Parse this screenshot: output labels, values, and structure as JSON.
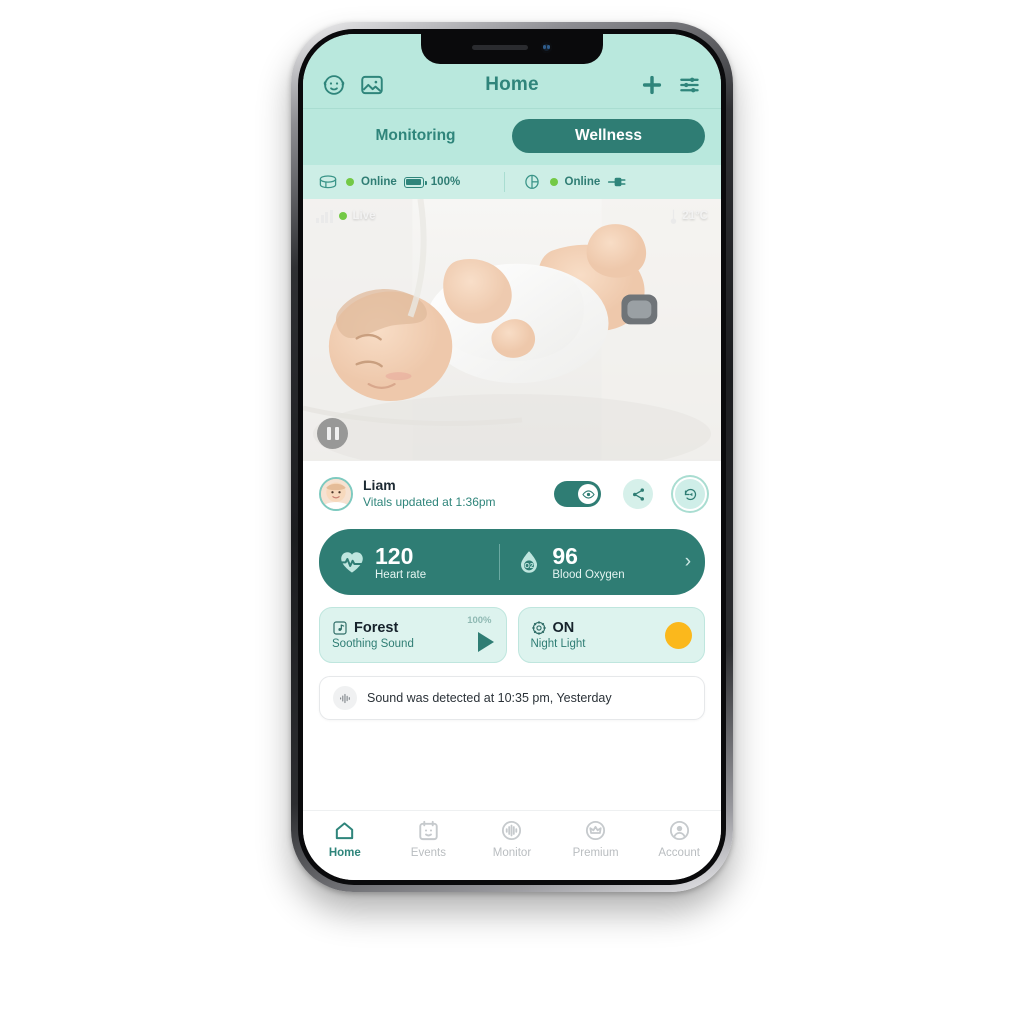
{
  "header": {
    "title": "Home",
    "baby_icon": "baby-face-icon",
    "gallery_icon": "gallery-icon",
    "add_icon": "plus-icon",
    "settings_icon": "sliders-icon"
  },
  "segments": [
    {
      "label": "Monitoring",
      "active": false
    },
    {
      "label": "Wellness",
      "active": true
    }
  ],
  "devices": [
    {
      "icon": "smart-sock-icon",
      "status": "Online",
      "battery": "100%"
    },
    {
      "icon": "camera-icon",
      "status": "Online",
      "power": "plugged-in"
    }
  ],
  "video": {
    "signal_icon": "signal-bars-icon",
    "live_label": "Live",
    "temperature": "21°C",
    "thermometer_icon": "thermometer-icon",
    "pause_icon": "pause-icon"
  },
  "baby": {
    "name": "Liam",
    "subtitle": "Vitals updated at 1:36pm",
    "eye_toggle": "on",
    "share_icon": "share-icon",
    "playback_icon": "playback-history-icon"
  },
  "vitals": [
    {
      "icon": "heart-pulse-icon",
      "value": "120",
      "label": "Heart rate"
    },
    {
      "icon": "blood-oxygen-icon",
      "value": "96",
      "label": "Blood Oxygen"
    }
  ],
  "vitals_chevron": "›",
  "tiles": {
    "sound": {
      "icon": "music-note-icon",
      "title": "Forest",
      "subtitle": "Soothing Sound",
      "volume": "100%",
      "action": "play-icon"
    },
    "light": {
      "icon": "night-light-icon",
      "title": "ON",
      "subtitle": "Night Light",
      "color": "#fbb81c"
    }
  },
  "notification": {
    "icon": "sound-wave-icon",
    "text": "Sound was detected at 10:35 pm, Yesterday"
  },
  "tabs": [
    {
      "label": "Home",
      "icon": "home-icon",
      "active": true
    },
    {
      "label": "Events",
      "icon": "calendar-icon",
      "active": false
    },
    {
      "label": "Monitor",
      "icon": "monitor-wave-icon",
      "active": false
    },
    {
      "label": "Premium",
      "icon": "crown-icon",
      "active": false
    },
    {
      "label": "Account",
      "icon": "account-icon",
      "active": false
    }
  ],
  "colors": {
    "mint_header": "#b9e8dd",
    "mint_strip": "#cdeee6",
    "teal_primary": "#2f7d74",
    "teal_text": "#2f857b",
    "tile_bg": "#ddf3ee",
    "online_green": "#73c945",
    "amber": "#fbb81c"
  }
}
